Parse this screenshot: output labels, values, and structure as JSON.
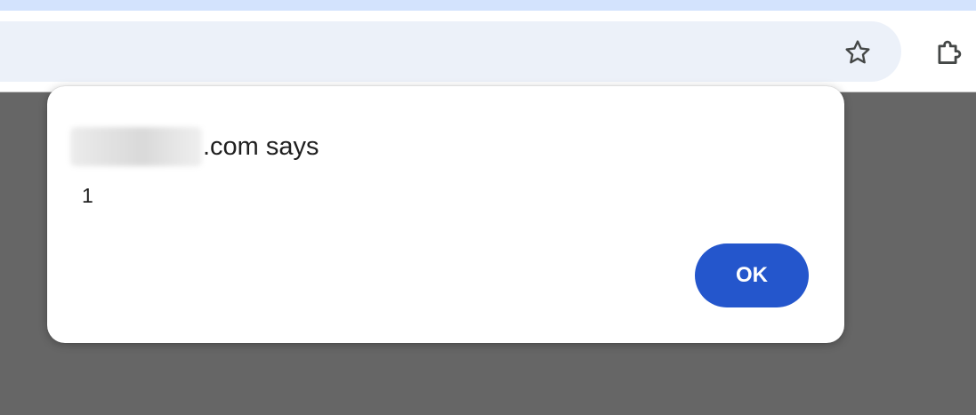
{
  "browser": {
    "toolbar": {
      "bookmark_icon": "star-icon",
      "extensions_icon": "puzzle-piece-icon"
    }
  },
  "alert_dialog": {
    "title_suffix": ".com says",
    "message": "1",
    "ok_label": "OK",
    "ok_color": "#2456cc"
  },
  "colors": {
    "tab_strip": "#d3e3fd",
    "omnibox": "#ecf1f9",
    "page_overlay": "#666666",
    "dialog_background": "#ffffff"
  }
}
